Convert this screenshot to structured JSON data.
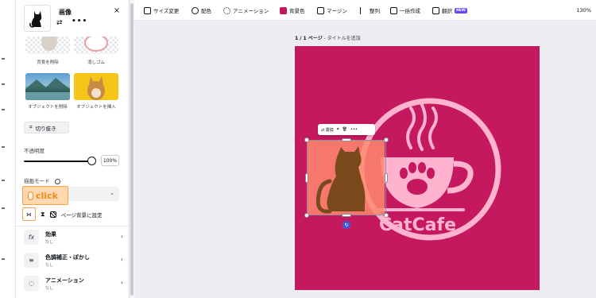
{
  "panel": {
    "title": "画像",
    "close": "×",
    "more": "•••",
    "tiles": [
      {
        "label": "背景を削除"
      },
      {
        "label": "消しゴム"
      },
      {
        "label": "オブジェクトを削除"
      },
      {
        "label": "オブジェクトを挿入"
      }
    ],
    "crop_label": "切り抜き",
    "opacity_label": "不透明度",
    "opacity_value": "100%",
    "opacity_level": 1.0,
    "blend_mode_label": "描画モード",
    "click_hint": "click",
    "page_bg_label": "ページ背景に設定",
    "properties": [
      {
        "name": "効果",
        "sub": "なし",
        "icon": "fx-icon",
        "glyph": "fx"
      },
      {
        "name": "色調補正・ぼかし",
        "sub": "なし",
        "icon": "sliders-icon",
        "glyph": "≡"
      },
      {
        "name": "アニメーション",
        "sub": "なし",
        "icon": "animation-icon",
        "glyph": "◌"
      }
    ]
  },
  "toolbar": {
    "items": [
      {
        "label": "サイズ変更",
        "icon": "resize-icon"
      },
      {
        "label": "配色",
        "icon": "palette-icon"
      },
      {
        "label": "アニメーション",
        "icon": "animation-icon"
      },
      {
        "label": "背景色",
        "icon": "color-swatch-icon"
      },
      {
        "label": "マージン",
        "icon": "margin-icon"
      },
      {
        "label": "整列",
        "icon": "align-icon"
      },
      {
        "label": "一括作成",
        "icon": "bulk-create-icon"
      },
      {
        "label": "翻訳",
        "icon": "translate-icon"
      }
    ],
    "new_badge": "NEW",
    "zoom": "130%"
  },
  "canvas": {
    "page_label_num": "1 / 1 ページ",
    "page_label_title": " - タイトルを追加",
    "logo_text": "CatCafe",
    "background": "#c4195e",
    "logo_color": "#ffb3cf"
  },
  "context_menu": {
    "replace": "置換"
  }
}
